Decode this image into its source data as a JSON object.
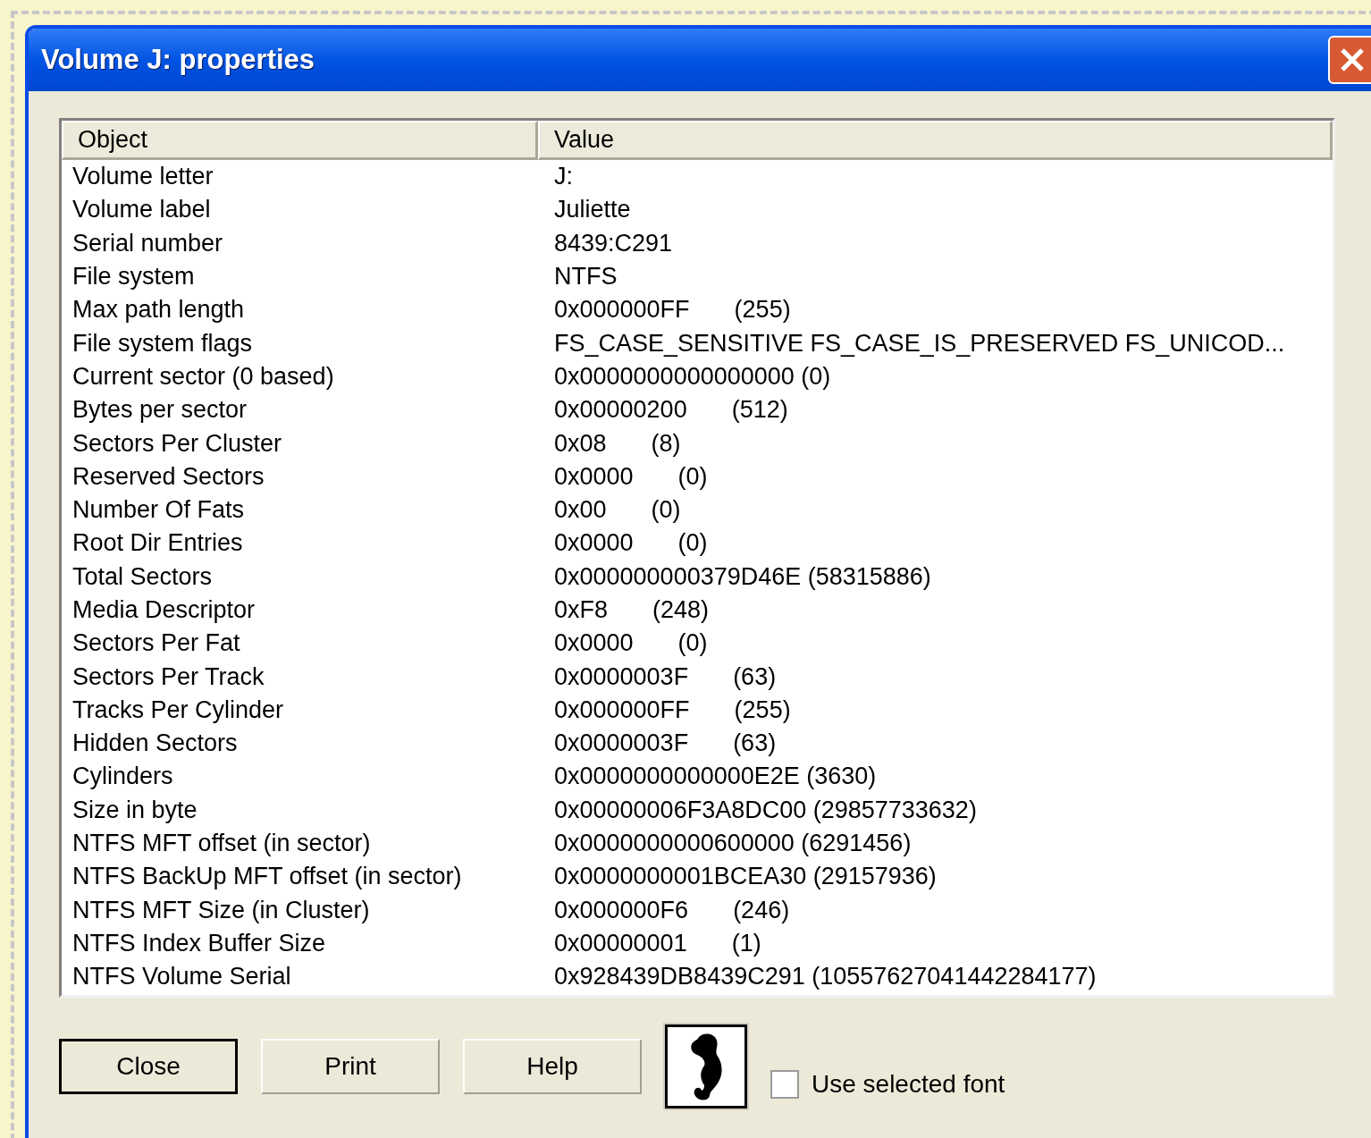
{
  "window": {
    "title": "Volume J: properties"
  },
  "table": {
    "columns": [
      "Object",
      "Value"
    ],
    "rows": [
      {
        "object": "Volume letter",
        "value": "J:"
      },
      {
        "object": "Volume label",
        "value": "Juliette"
      },
      {
        "object": "Serial number",
        "value": "8439:C291"
      },
      {
        "object": "File system",
        "value": "NTFS"
      },
      {
        "object": "Max path length",
        "value": "0x000000FF",
        "decimal": "(255)"
      },
      {
        "object": "File system flags",
        "value": "FS_CASE_SENSITIVE FS_CASE_IS_PRESERVED FS_UNICOD..."
      },
      {
        "object": "Current sector (0 based)",
        "value": "0x0000000000000000 (0)"
      },
      {
        "object": "Bytes per sector",
        "value": "0x00000200",
        "decimal": "(512)"
      },
      {
        "object": "Sectors Per Cluster",
        "value": "0x08",
        "decimal": "(8)"
      },
      {
        "object": "Reserved Sectors",
        "value": "0x0000",
        "decimal": "(0)"
      },
      {
        "object": "Number Of Fats",
        "value": "0x00",
        "decimal": "(0)"
      },
      {
        "object": "Root Dir Entries",
        "value": "0x0000",
        "decimal": "(0)"
      },
      {
        "object": "Total Sectors",
        "value": "0x000000000379D46E (58315886)"
      },
      {
        "object": "Media Descriptor",
        "value": "0xF8",
        "decimal": "(248)"
      },
      {
        "object": "Sectors Per Fat",
        "value": "0x0000",
        "decimal": "(0)"
      },
      {
        "object": "Sectors Per Track",
        "value": "0x0000003F",
        "decimal": "(63)"
      },
      {
        "object": "Tracks Per Cylinder",
        "value": "0x000000FF",
        "decimal": "(255)"
      },
      {
        "object": "Hidden Sectors",
        "value": "0x0000003F",
        "decimal": "(63)"
      },
      {
        "object": "Cylinders",
        "value": "0x0000000000000E2E (3630)"
      },
      {
        "object": "Size in byte",
        "value": "0x00000006F3A8DC00 (29857733632)"
      },
      {
        "object": "NTFS MFT offset (in sector)",
        "value": "0x0000000000600000 (6291456)"
      },
      {
        "object": "NTFS BackUp MFT offset (in sector)",
        "value": "0x0000000001BCEA30 (29157936)"
      },
      {
        "object": "NTFS MFT Size (in Cluster)",
        "value": "0x000000F6",
        "decimal": "(246)"
      },
      {
        "object": "NTFS Index Buffer Size",
        "value": "0x00000001",
        "decimal": "(1)"
      },
      {
        "object": "NTFS Volume Serial",
        "value": "0x928439DB8439C291 (10557627041442284177)"
      }
    ]
  },
  "buttons": [
    {
      "label": "Close",
      "default": true
    },
    {
      "label": "Print",
      "default": false
    },
    {
      "label": "Help",
      "default": false
    }
  ],
  "font_checkbox": {
    "label": "Use selected font",
    "checked": false
  }
}
